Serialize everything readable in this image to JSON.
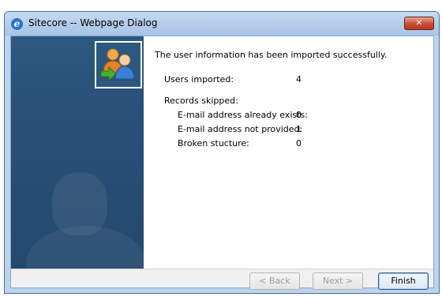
{
  "window": {
    "title": "Sitecore -- Webpage Dialog",
    "close_glyph": "✕",
    "browser_icon_glyph": "e"
  },
  "content": {
    "message": "The user information has been imported successfully.",
    "users_imported_label": "Users imported:",
    "users_imported_value": "4",
    "records_skipped_label": "Records skipped:",
    "skipped": [
      {
        "label": "E-mail address already exists:",
        "value": "0"
      },
      {
        "label": "E-mail address not provided:",
        "value": "1"
      },
      {
        "label": "Broken stucture:",
        "value": "0"
      }
    ]
  },
  "icons": {
    "browser": "internet-explorer-icon",
    "banner": "users-import-icon",
    "close": "close-icon"
  },
  "buttons": {
    "back": "< Back",
    "next": "Next >",
    "finish": "Finish"
  }
}
